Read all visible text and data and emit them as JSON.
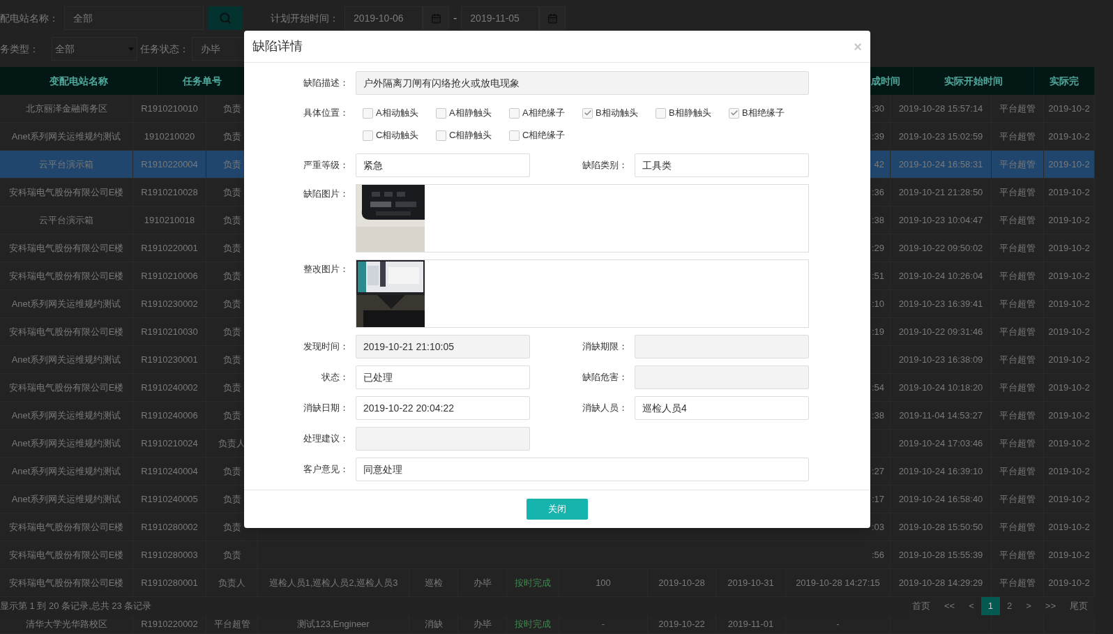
{
  "filters": {
    "station": {
      "label": "配电站名称：",
      "value": "全部"
    },
    "plan_start": {
      "label": "计划开始时间：",
      "from": "2019-10-06",
      "separator": "-",
      "to": "2019-11-05"
    },
    "task_type": {
      "label": "务类型：",
      "value": "全部"
    },
    "task_status": {
      "label": "任务状态：",
      "value": "办毕"
    }
  },
  "table": {
    "columns": [
      {
        "label": "变配电站名称",
        "kind": "left"
      },
      {
        "label": "任务单号",
        "kind": "left"
      },
      {
        "label": "成时间",
        "kind": "tail"
      },
      {
        "label": "实际开始时间",
        "kind": "right"
      },
      {
        "label": "实际完",
        "kind": "right"
      }
    ],
    "rows": [
      {
        "kind": "partial",
        "selected": false,
        "column_1": "北京丽泽金融商务区",
        "column_2": "R1910210010",
        "column_3": "负责",
        "column_11": ":30",
        "column_12": "2019-10-28 15:57:14",
        "column_13": "平台超管",
        "column_14": "2019-10-2"
      },
      {
        "kind": "partial",
        "selected": false,
        "column_1": "Anet系列网关运维规约测试",
        "column_2": "1910210020",
        "column_3": "负责",
        "column_11": ":39",
        "column_12": "2019-10-23 15:02:59",
        "column_13": "平台超管",
        "column_14": "2019-10-2"
      },
      {
        "kind": "partial",
        "selected": true,
        "column_1": "云平台演示箱",
        "column_2": "R1910220004",
        "column_3": "负责",
        "column_11": "42",
        "column_12": "2019-10-24 16:58:31",
        "column_13": "平台超管",
        "column_14": "2019-10-2"
      },
      {
        "kind": "partial",
        "selected": false,
        "column_1": "安科瑞电气股份有限公司E楼",
        "column_2": "R1910210028",
        "column_3": "负责",
        "column_11": ":36",
        "column_12": "2019-10-21 21:28:50",
        "column_13": "平台超管",
        "column_14": "2019-10-2"
      },
      {
        "kind": "partial",
        "selected": false,
        "column_1": "云平台演示箱",
        "column_2": "1910210018",
        "column_3": "负责",
        "column_11": ":38",
        "column_12": "2019-10-23 10:04:47",
        "column_13": "平台超管",
        "column_14": "2019-10-2"
      },
      {
        "kind": "partial",
        "selected": false,
        "column_1": "安科瑞电气股份有限公司E楼",
        "column_2": "R1910220001",
        "column_3": "负责",
        "column_11": ":29",
        "column_12": "2019-10-22 09:50:02",
        "column_13": "平台超管",
        "column_14": "2019-10-2"
      },
      {
        "kind": "partial",
        "selected": false,
        "column_1": "安科瑞电气股份有限公司E楼",
        "column_2": "R1910210006",
        "column_3": "负责",
        "column_11": ":51",
        "column_12": "2019-10-24 10:26:04",
        "column_13": "平台超管",
        "column_14": "2019-10-2"
      },
      {
        "kind": "partial",
        "selected": false,
        "column_1": "Anet系列网关运维规约测试",
        "column_2": "R1910230002",
        "column_3": "负责",
        "column_11": ":10",
        "column_12": "2019-10-23 16:39:41",
        "column_13": "平台超管",
        "column_14": "2019-10-2"
      },
      {
        "kind": "partial",
        "selected": false,
        "column_1": "安科瑞电气股份有限公司E楼",
        "column_2": "R1910210030",
        "column_3": "负责",
        "column_11": ":19",
        "column_12": "2019-10-22 09:31:46",
        "column_13": "平台超管",
        "column_14": "2019-10-2"
      },
      {
        "kind": "partial",
        "selected": false,
        "column_1": "Anet系列网关运维规约测试",
        "column_2": "R1910230001",
        "column_3": "负责",
        "column_12": "2019-10-23 16:38:09",
        "column_13": "平台超管",
        "column_14": "2019-10-2"
      },
      {
        "kind": "partial",
        "selected": false,
        "column_1": "安科瑞电气股份有限公司E楼",
        "column_2": "R1910240002",
        "column_3": "负责",
        "column_11": ":54",
        "column_12": "2019-10-24 10:18:20",
        "column_13": "平台超管",
        "column_14": "2019-10-2"
      },
      {
        "kind": "partial",
        "selected": false,
        "column_1": "Anet系列网关运维规约测试",
        "column_2": "R1910240006",
        "column_3": "负责",
        "column_11": ":38",
        "column_12": "2019-11-04 14:53:27",
        "column_13": "平台超管",
        "column_14": "2019-10-2"
      },
      {
        "kind": "partial",
        "selected": false,
        "column_1": "Anet系列网关运维规约测试",
        "column_2": "R1910210024",
        "column_3": "负责人",
        "column_12": "2019-10-24 17:03:46",
        "column_13": "平台超管",
        "column_14": "2019-10-2"
      },
      {
        "kind": "partial",
        "selected": false,
        "column_1": "Anet系列网关运维规约测试",
        "column_2": "R1910240004",
        "column_3": "负责",
        "column_11": ":27",
        "column_12": "2019-10-24 16:39:10",
        "column_13": "平台超管",
        "column_14": "2019-10-2"
      },
      {
        "kind": "partial",
        "selected": false,
        "column_1": "Anet系列网关运维规约测试",
        "column_2": "R1910240005",
        "column_3": "负责",
        "column_11": ":17",
        "column_12": "2019-10-24 16:58:40",
        "column_13": "平台超管",
        "column_14": "2019-10-2"
      },
      {
        "kind": "partial",
        "selected": false,
        "column_1": "安科瑞电气股份有限公司E楼",
        "column_2": "R1910280002",
        "column_3": "负责",
        "column_11": ":03",
        "column_12": "2019-10-28 15:50:50",
        "column_13": "平台超管",
        "column_14": "2019-10-2"
      },
      {
        "kind": "partial",
        "selected": false,
        "column_1": "安科瑞电气股份有限公司E楼",
        "column_2": "R1910280003",
        "column_3": "负责",
        "column_11": ":56",
        "column_12": "2019-10-28 15:55:39",
        "column_13": "平台超管",
        "column_14": "2019-10-2"
      },
      {
        "kind": "full",
        "selected": false,
        "column_1": "安科瑞电气股份有限公司E楼",
        "column_2": "R1910280001",
        "column_3": "负责人",
        "column_4": "巡检人员1,巡检人员2,巡检人员3",
        "column_5": "巡检",
        "column_6": "办毕",
        "column_7": "按时完成",
        "column_8": "100",
        "column_9": "2019-10-28",
        "column_10": "2019-10-31",
        "column_11": "2019-10-28 14:27:15",
        "column_12": "2019-10-28 14:29:29",
        "column_13": "平台超管",
        "column_14": "2019-10-2"
      },
      {
        "kind": "full",
        "selected": false,
        "column_1": "清华大学光华路校区",
        "column_2": "R1910220002",
        "column_3": "平台超管",
        "column_4": "测试123,Engineer",
        "column_5": "消缺",
        "column_6": "办毕",
        "column_7": "按时完成",
        "column_8": "-",
        "column_9": "2019-10-22",
        "column_10": "2019-11-01",
        "column_11": "-"
      }
    ]
  },
  "footer": {
    "summary": "显示第 1 到 20 条记录,总共 23 条记录",
    "pages": [
      {
        "label": "首页",
        "selected": false
      },
      {
        "label": "<<",
        "selected": false
      },
      {
        "label": "<",
        "selected": false
      },
      {
        "label": "1",
        "selected": true
      },
      {
        "label": "2",
        "selected": false
      },
      {
        "label": ">",
        "selected": false
      },
      {
        "label": ">>",
        "selected": false
      },
      {
        "label": "尾页",
        "selected": false
      }
    ]
  },
  "modal": {
    "title": "缺陷详情",
    "close": "×",
    "button": "关闭",
    "rows": [
      {
        "kind": "wide",
        "fields": [
          {
            "label": "缺陷描述：",
            "value": "户外隔离刀闸有闪络抢火或放电现象",
            "disabled": true
          }
        ]
      },
      {
        "kind": "checks",
        "label": "具体位置：",
        "options": [
          {
            "label": "A相动触头",
            "checked": false
          },
          {
            "label": "A相静触头",
            "checked": false
          },
          {
            "label": "A相绝缘子",
            "checked": false
          },
          {
            "label": "B相动触头",
            "checked": true
          },
          {
            "label": "B相静触头",
            "checked": false
          },
          {
            "label": "B相绝缘子",
            "checked": true
          },
          {
            "label": "C相动触头",
            "checked": false
          },
          {
            "label": "C相静触头",
            "checked": false
          },
          {
            "label": "C相绝缘子",
            "checked": false
          }
        ]
      },
      {
        "kind": "pair",
        "fields": [
          {
            "label": "严重等级：",
            "value": "紧急",
            "disabled": false
          },
          {
            "label": "缺陷类别：",
            "value": "工具类",
            "disabled": false
          }
        ]
      },
      {
        "label": "缺陷图片："
      },
      {
        "label": "整改图片："
      },
      {
        "kind": "pair",
        "fields": [
          {
            "label": "发现时间：",
            "value": "2019-10-21 21:10:05",
            "disabled": true
          },
          {
            "label": "消缺期限：",
            "disabled": true
          }
        ]
      },
      {
        "kind": "pair",
        "fields": [
          {
            "label": "状态：",
            "value": "已处理",
            "disabled": false
          },
          {
            "label": "缺陷危害：",
            "disabled": true
          }
        ]
      },
      {
        "kind": "pair",
        "fields": [
          {
            "label": "消缺日期：",
            "value": "2019-10-22 20:04:22",
            "disabled": false
          },
          {
            "label": "消缺人员：",
            "value": "巡检人员4",
            "disabled": false
          }
        ]
      },
      {
        "kind": "pair",
        "fields": [
          {
            "label": "处理建议：",
            "disabled": true
          }
        ]
      },
      {
        "kind": "wide",
        "fields": [
          {
            "label": "客户意见：",
            "value": "同意处理",
            "disabled": false
          }
        ]
      }
    ]
  }
}
